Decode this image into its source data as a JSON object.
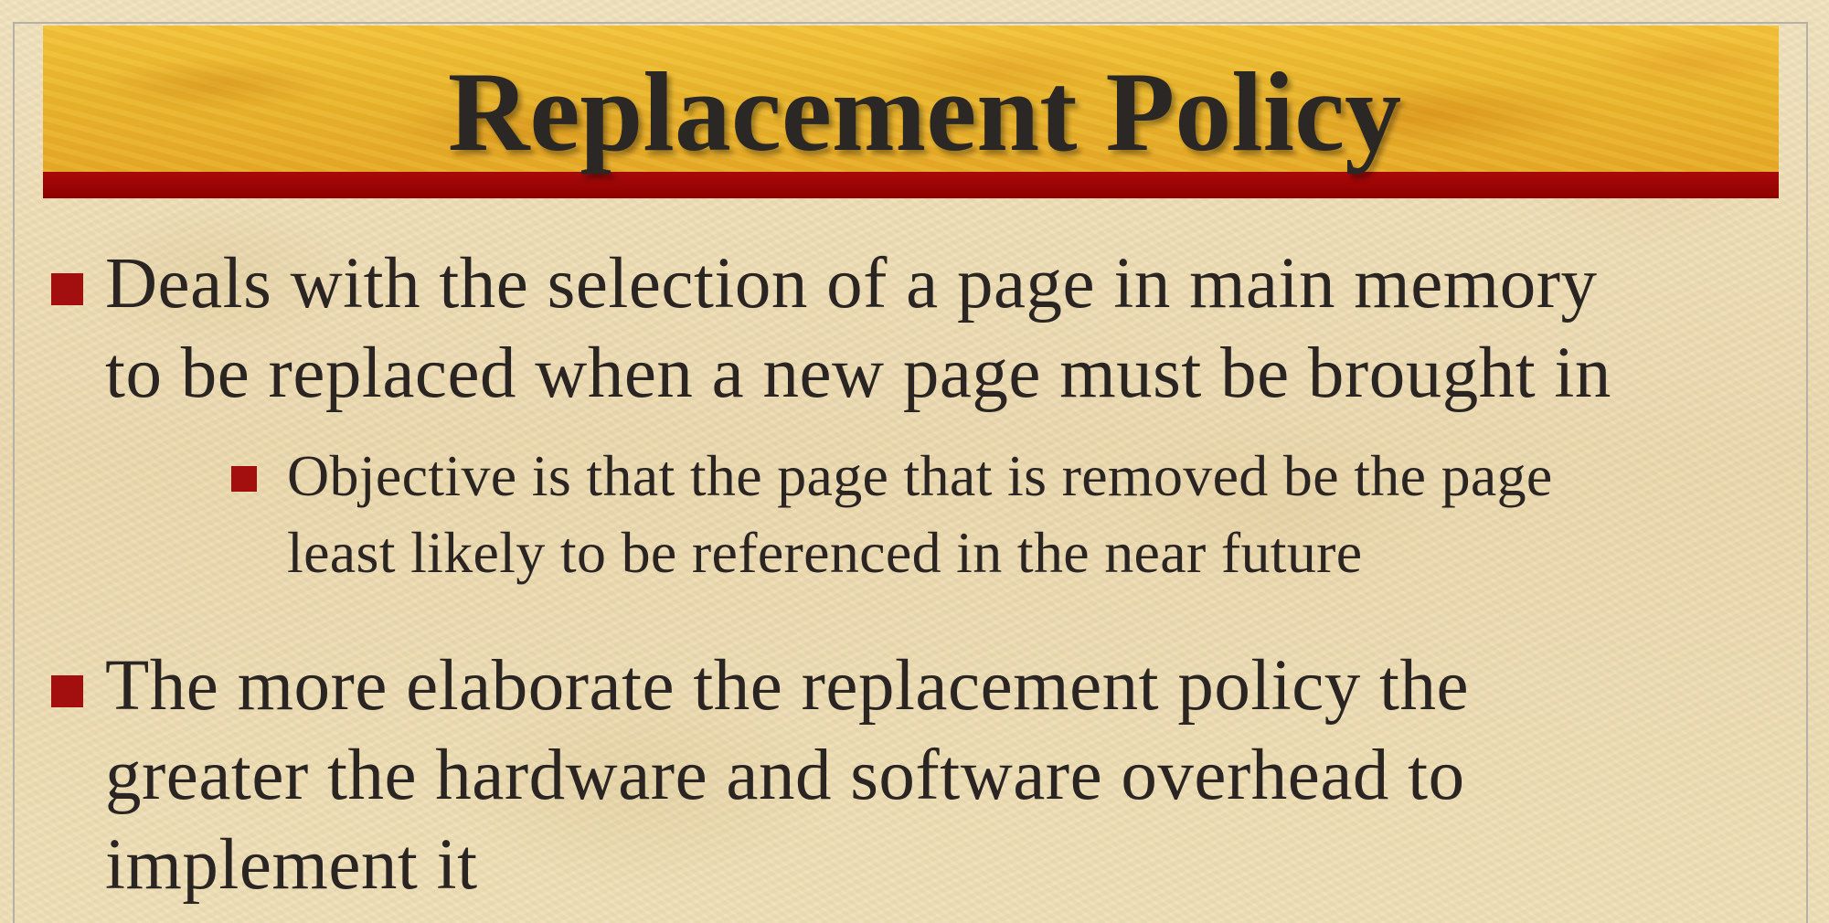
{
  "slide": {
    "title": "Replacement Policy",
    "bullets": [
      {
        "level": 1,
        "lines": [
          "Deals with the selection of a page in main memory",
          "to be replaced when a new page must be brought in"
        ]
      },
      {
        "level": 2,
        "lines": [
          "Objective is that the page that is removed be the page",
          "least likely to be referenced in the near future"
        ]
      },
      {
        "level": 1,
        "lines": [
          "The more elaborate the replacement policy the",
          "greater the hardware and software overhead to",
          "implement it"
        ]
      }
    ]
  },
  "colors": {
    "title_band": "#e9b62e",
    "title_underline": "#8f0000",
    "bullet": "#a30e0e",
    "text": "#2a2523",
    "background": "#ecd9ae"
  }
}
